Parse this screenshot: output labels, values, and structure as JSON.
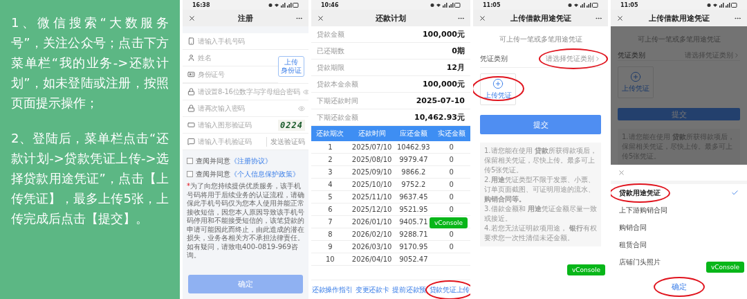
{
  "instructions": [
    "1、微信搜索“大数服务号”，关注公众号；点击下方菜单栏“我的业务->还款计划”，如未登陆或注册，按照页面提示操作；",
    "2、登陆后，菜单栏点击“还款计划->贷款凭证上传->选择贷款用途凭证”，点击【上传凭证】，最多上传5张，上传完成后点击【提交】。"
  ],
  "register": {
    "status_time": "16:38",
    "title": "注册",
    "fields": [
      {
        "kind": "phone",
        "placeholder": "请输入手机号码"
      },
      {
        "kind": "identity_group",
        "fields": [
          {
            "kind": "person",
            "placeholder": "姓名"
          },
          {
            "kind": "id",
            "placeholder": "身份证号"
          }
        ],
        "button": [
          "上传",
          "身份证"
        ]
      },
      {
        "kind": "password",
        "placeholder": "请设置8-16位数字与字母组合密码",
        "reveal": true
      },
      {
        "kind": "password",
        "placeholder": "请再次输入密码",
        "reveal": true
      },
      {
        "kind": "captcha",
        "placeholder": "请输入图形验证码",
        "captcha_image": "0224"
      },
      {
        "kind": "sms",
        "placeholder": "请输入手机验证码",
        "action": "发送验证码"
      }
    ],
    "agreements": [
      {
        "checked": false,
        "prefix": "查阅并同意",
        "link": "《注册协议》"
      },
      {
        "checked": false,
        "prefix": "查阅并同意",
        "link": "《个人信息保护政策》"
      }
    ],
    "notice_mark": "*",
    "notice": "为了向您持续提供优质服务，该手机号码将用于后续业务的认证流程，请确保此手机号码仅为您本人使用并能正常接收短信，因您本人原因导致该手机号码停用和不能接受短信的，该笔贷款的申请可能因此而终止，由此造成的潜在损失，业务各相关方不承担法律责任。如有疑问，请致电400-0819-969咨询。",
    "confirm": "确定"
  },
  "schedule": {
    "status_time": "10:46",
    "title": "还款计划",
    "summary": [
      {
        "label": "贷款金额",
        "value": "100,000元"
      },
      {
        "label": "已还期数",
        "value": "0期"
      },
      {
        "label": "贷款期限",
        "value": "12月"
      },
      {
        "label": "贷款本金余额",
        "value": "100,000元"
      },
      {
        "label": "下期还款时间",
        "value": "2025-07-10"
      },
      {
        "label": "下期还款金额",
        "value": "10,462.93元"
      }
    ],
    "table": {
      "columns": [
        "还款期次",
        "还款时间",
        "应还金额",
        "实还金额"
      ],
      "rows": [
        [
          "1",
          "2025/07/10",
          "10462.93",
          "0"
        ],
        [
          "2",
          "2025/08/10",
          "9979.47",
          "0"
        ],
        [
          "3",
          "2025/09/10",
          "9866.2",
          "0"
        ],
        [
          "4",
          "2025/10/10",
          "9752.2",
          "0"
        ],
        [
          "5",
          "2025/11/10",
          "9637.45",
          "0"
        ],
        [
          "6",
          "2025/12/10",
          "9521.95",
          "0"
        ],
        [
          "7",
          "2026/01/10",
          "9405.71"
        ],
        [
          "8",
          "2026/02/10",
          "9288.71",
          "0"
        ],
        [
          "9",
          "2026/03/10",
          "9170.95",
          "0"
        ],
        [
          "10",
          "2026/04/10",
          "9052.47"
        ]
      ]
    },
    "links": [
      "还款操作指引",
      "变更还款卡",
      "提前还款预",
      "贷款凭证上传"
    ],
    "vconsole": "vConsole"
  },
  "upload": {
    "status_time": "11:05",
    "title": "上传借款用途凭证",
    "hint": "可上传一笔或多笔用途凭证",
    "category_label": "凭证类别",
    "category_placeholder": "请选择凭证类别",
    "upload_label": "上传凭证",
    "submit": "提交",
    "notes": [
      "1.请您能在使用 **贷款**所获得款项后，保留相关凭证，尽快上传。最多可上传5张凭证。",
      "2.**用途**凭证类型不限于发票、小票、订单页面截图、可证明用途的流水、**购销合同等。**",
      "3.借款金额和 **用途**凭证金额尽量一致或接近。",
      "4.若您无法证明款项用途， **银行**有权要求您一次性清偿未还金额。"
    ],
    "vconsole": "vConsole"
  },
  "upload_sheet": {
    "status_time": "11:05",
    "title": "上传借款用途凭证",
    "hint": "可上传一笔或多笔用途凭证",
    "category_label": "凭证类别",
    "category_placeholder": "请选择凭证类别",
    "upload_label": "上传凭证",
    "submit": "提交",
    "note": "1.请您能在使用 **贷款**所获得款项后，保留相关凭证，尽快上传。最多可上传5张凭证。",
    "options": [
      {
        "label": "贷款用途凭证",
        "selected": true
      },
      {
        "label": "上下游购销合同",
        "selected": false
      },
      {
        "label": "购销合同",
        "selected": false
      },
      {
        "label": "租赁合同",
        "selected": false
      },
      {
        "label": "店铺门头照片",
        "selected": false
      }
    ],
    "confirm": "确定",
    "vconsole": "vConsole"
  }
}
